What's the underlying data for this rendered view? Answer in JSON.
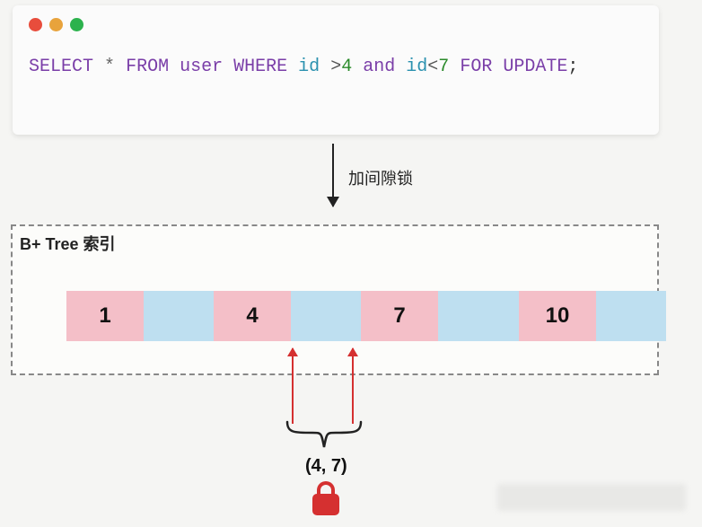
{
  "codeBlock": {
    "tokens": {
      "select": "SELECT",
      "star": "*",
      "from": "FROM",
      "table": "user",
      "where": "WHERE",
      "col1": "id",
      "op1": ">",
      "val1": "4",
      "and": "and",
      "col2": "id",
      "op2": "<",
      "val2": "7",
      "for": "FOR",
      "update": "UPDATE",
      "semi": ";"
    }
  },
  "arrow": {
    "label": "加间隙锁"
  },
  "btree": {
    "title": "B+ Tree 索引",
    "keys": [
      "1",
      "4",
      "7",
      "10"
    ]
  },
  "range": {
    "label": "(4,  7)"
  }
}
